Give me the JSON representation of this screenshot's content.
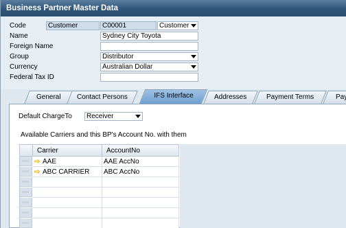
{
  "window": {
    "title": "Business Partner Master Data"
  },
  "header": {
    "code_label": "Code",
    "type_value": "Customer",
    "code_value": "C00001",
    "type_select": "Customer",
    "name_label": "Name",
    "name_value": "Sydney City  Toyota",
    "foreign_name_label": "Foreign Name",
    "foreign_name_value": "",
    "group_label": "Group",
    "group_value": "Distributor",
    "currency_label": "Currency",
    "currency_value": "Australian Dollar",
    "federal_tax_label": "Federal Tax ID",
    "federal_tax_value": ""
  },
  "tabs": [
    {
      "label": "General",
      "active": false
    },
    {
      "label": "Contact Persons",
      "active": false
    },
    {
      "label": "IFS Interface",
      "active": true
    },
    {
      "label": "Addresses",
      "active": false
    },
    {
      "label": "Payment Terms",
      "active": false
    },
    {
      "label": "Pay",
      "active": false
    }
  ],
  "ifs": {
    "default_charge_label": "Default ChargeTo",
    "default_charge_value": "Receiver",
    "available_carriers_text": "Available Carriers and this BP's Account No. with them",
    "columns": [
      "Carrier",
      "AccountNo"
    ],
    "rows": [
      {
        "carrier": "AAE",
        "account": "AAE AccNo"
      },
      {
        "carrier": "ABC CARRIER",
        "account": "ABC AccNo"
      }
    ]
  },
  "colors": {
    "title_bar": "#2f5679",
    "active_tab": "#7aa6d6",
    "link_arrow": "#f0b400"
  }
}
